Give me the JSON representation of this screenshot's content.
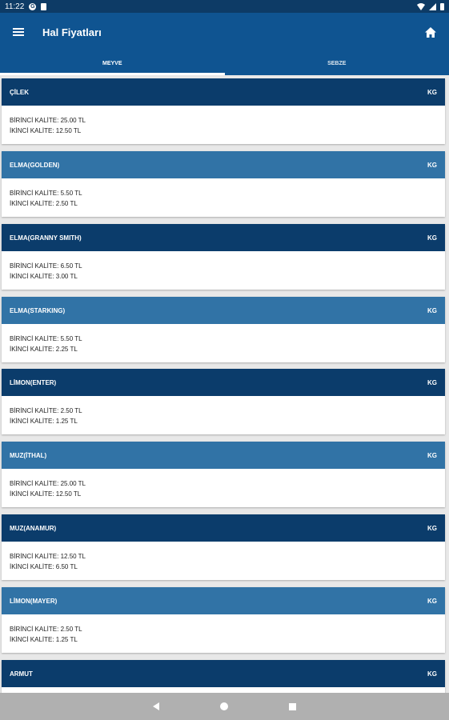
{
  "status_bar": {
    "time": "11:22",
    "g_label": "G"
  },
  "app_bar": {
    "title": "Hal Fiyatları"
  },
  "tabs": [
    {
      "label": "MEYVE",
      "active": true
    },
    {
      "label": "SEBZE",
      "active": false
    }
  ],
  "quality_labels": {
    "first": "BİRİNCİ KALİTE:",
    "second": "İKİNCİ KALİTE:"
  },
  "items": [
    {
      "name": "ÇİLEK",
      "unit": "KG",
      "first": "BİRİNCİ KALİTE: 25.00 TL",
      "second": "İKİNCİ KALİTE: 12.50 TL"
    },
    {
      "name": "ELMA(GOLDEN)",
      "unit": "KG",
      "first": "BİRİNCİ KALİTE: 5.50 TL",
      "second": "İKİNCİ KALİTE: 2.50 TL"
    },
    {
      "name": "ELMA(GRANNY SMITH)",
      "unit": "KG",
      "first": "BİRİNCİ KALİTE: 6.50 TL",
      "second": "İKİNCİ KALİTE: 3.00 TL"
    },
    {
      "name": "ELMA(STARKING)",
      "unit": "KG",
      "first": "BİRİNCİ KALİTE: 5.50 TL",
      "second": "İKİNCİ KALİTE: 2.25 TL"
    },
    {
      "name": "LİMON(ENTER)",
      "unit": "KG",
      "first": "BİRİNCİ KALİTE: 2.50 TL",
      "second": "İKİNCİ KALİTE: 1.25 TL"
    },
    {
      "name": "MUZ(İTHAL)",
      "unit": "KG",
      "first": "BİRİNCİ KALİTE: 25.00 TL",
      "second": "İKİNCİ KALİTE: 12.50 TL"
    },
    {
      "name": "MUZ(ANAMUR)",
      "unit": "KG",
      "first": "BİRİNCİ KALİTE: 12.50 TL",
      "second": "İKİNCİ KALİTE: 6.50 TL"
    },
    {
      "name": "LİMON(MAYER)",
      "unit": "KG",
      "first": "BİRİNCİ KALİTE: 2.50 TL",
      "second": "İKİNCİ KALİTE: 1.25 TL"
    },
    {
      "name": "ARMUT",
      "unit": "KG",
      "first": "",
      "second": ""
    }
  ],
  "colors": {
    "primary": "#0f5491",
    "header_dark": "#0b3c6b",
    "header_light": "#3173a6",
    "nav_bar": "#b0b0b0"
  },
  "icons": {
    "menu": "menu-icon",
    "home": "home-icon",
    "back": "back-icon",
    "nav_home": "nav-home-icon",
    "recents": "recents-icon"
  }
}
